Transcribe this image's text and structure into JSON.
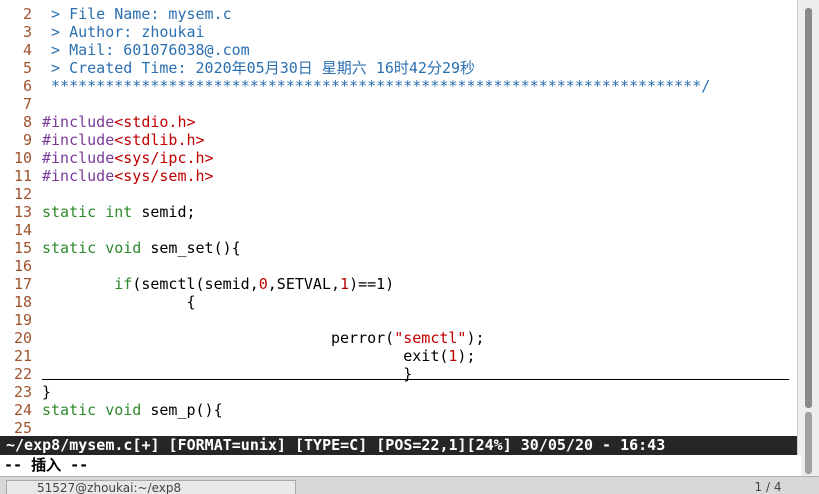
{
  "lines": [
    {
      "n": "2",
      "segs": [
        {
          "t": " > File Name: mysem.c",
          "c": "cmt"
        }
      ]
    },
    {
      "n": "3",
      "segs": [
        {
          "t": " > Author: zhoukai",
          "c": "cmt"
        }
      ]
    },
    {
      "n": "4",
      "segs": [
        {
          "t": " > Mail: 601076038@.com",
          "c": "cmt"
        }
      ]
    },
    {
      "n": "5",
      "segs": [
        {
          "t": " > Created Time: 2020年05月30日 星期六 16时42分29秒",
          "c": "cmt"
        }
      ]
    },
    {
      "n": "6",
      "segs": [
        {
          "t": " ************************************************************************/",
          "c": "cmt"
        }
      ]
    },
    {
      "n": "7",
      "segs": []
    },
    {
      "n": "8",
      "segs": [
        {
          "t": "#include",
          "c": "pp"
        },
        {
          "t": "<stdio.h>",
          "c": "str"
        }
      ]
    },
    {
      "n": "9",
      "segs": [
        {
          "t": "#include",
          "c": "pp"
        },
        {
          "t": "<stdlib.h>",
          "c": "str"
        }
      ]
    },
    {
      "n": "10",
      "segs": [
        {
          "t": "#include",
          "c": "pp"
        },
        {
          "t": "<sys/ipc.h>",
          "c": "str"
        }
      ]
    },
    {
      "n": "11",
      "segs": [
        {
          "t": "#include",
          "c": "pp"
        },
        {
          "t": "<sys/sem.h>",
          "c": "str"
        }
      ]
    },
    {
      "n": "12",
      "segs": []
    },
    {
      "n": "13",
      "segs": [
        {
          "t": "static int",
          "c": "kw"
        },
        {
          "t": " semid;",
          "c": "pl"
        }
      ]
    },
    {
      "n": "14",
      "segs": []
    },
    {
      "n": "15",
      "segs": [
        {
          "t": "static void",
          "c": "kw"
        },
        {
          "t": " sem_set(){",
          "c": "pl"
        }
      ]
    },
    {
      "n": "16",
      "segs": []
    },
    {
      "n": "17",
      "segs": [
        {
          "t": "        ",
          "c": "pl"
        },
        {
          "t": "if",
          "c": "kw"
        },
        {
          "t": "(semctl(semid,",
          "c": "pl"
        },
        {
          "t": "0",
          "c": "num"
        },
        {
          "t": ",SETVAL,",
          "c": "pl"
        },
        {
          "t": "1",
          "c": "num"
        },
        {
          "t": ")==1)",
          "c": "pl"
        }
      ]
    },
    {
      "n": "18",
      "segs": [
        {
          "t": "                {",
          "c": "pl"
        }
      ]
    },
    {
      "n": "19",
      "segs": []
    },
    {
      "n": "20",
      "segs": [
        {
          "t": "                                perror(",
          "c": "pl"
        },
        {
          "t": "\"semctl\"",
          "c": "str"
        },
        {
          "t": ");",
          "c": "pl"
        }
      ]
    },
    {
      "n": "21",
      "segs": [
        {
          "t": "                                        exit(",
          "c": "pl"
        },
        {
          "t": "1",
          "c": "num"
        },
        {
          "t": ");",
          "c": "pl"
        }
      ]
    },
    {
      "n": "22",
      "segs": [
        {
          "t": "                                        }",
          "c": "pl"
        }
      ]
    },
    {
      "n": "23",
      "segs": [
        {
          "t": "}",
          "c": "pl"
        }
      ]
    },
    {
      "n": "24",
      "segs": [
        {
          "t": "static void",
          "c": "kw"
        },
        {
          "t": " sem_p(){",
          "c": "pl"
        }
      ]
    },
    {
      "n": "25",
      "segs": []
    }
  ],
  "statusline": "~/exp8/mysem.c[+] [FORMAT=unix] [TYPE=C] [POS=22,1][24%] 30/05/20 - 16:43",
  "cmdline": "-- 插入 --",
  "taskbar": {
    "item_label": "51527@zhoukai:~/exp8",
    "page_indicator": "1 / 4"
  },
  "colors": {
    "comment": "#2a6fb0",
    "preproc": "#7a3a99",
    "string": "#c00000",
    "keyword": "#2d8a2d",
    "line_number": "#a0522d",
    "statusline_bg": "#262626"
  }
}
